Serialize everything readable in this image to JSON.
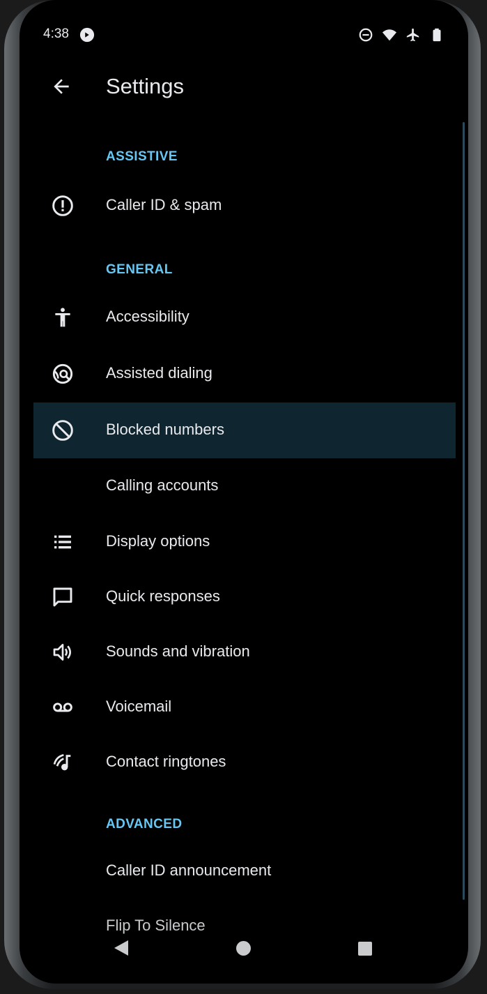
{
  "status_bar": {
    "time": "4:38",
    "icons": [
      "app-notification-icon",
      "do-not-disturb-icon",
      "wifi-icon",
      "airplane-icon",
      "battery-icon"
    ]
  },
  "app_bar": {
    "title": "Settings",
    "back_icon": "arrow-back-icon"
  },
  "sections": {
    "assistive": "ASSISTIVE",
    "general": "GENERAL",
    "advanced": "ADVANCED"
  },
  "items": {
    "caller_id_spam": {
      "label": "Caller ID & spam",
      "icon": "info-circle-icon"
    },
    "accessibility": {
      "label": "Accessibility",
      "icon": "accessibility-icon"
    },
    "assisted_dialing": {
      "label": "Assisted dialing",
      "icon": "assisted-dialing-icon"
    },
    "blocked_numbers": {
      "label": "Blocked numbers",
      "icon": "block-icon"
    },
    "calling_accounts": {
      "label": "Calling accounts"
    },
    "display_options": {
      "label": "Display options",
      "icon": "list-icon"
    },
    "quick_responses": {
      "label": "Quick responses",
      "icon": "message-icon"
    },
    "sounds_vibration": {
      "label": "Sounds and vibration",
      "icon": "volume-icon"
    },
    "voicemail": {
      "label": "Voicemail",
      "icon": "voicemail-icon"
    },
    "contact_ringtones": {
      "label": "Contact ringtones",
      "icon": "ringtone-icon"
    },
    "caller_id_announcement": {
      "label": "Caller ID announcement"
    },
    "flip_to_silence": {
      "label": "Flip To Silence"
    }
  },
  "selected_item": "blocked_numbers",
  "nav_bar": [
    "nav-back-icon",
    "nav-home-icon",
    "nav-recents-icon"
  ],
  "colors": {
    "accent": "#66c7f4",
    "background": "#000000",
    "text": "#e8eaed",
    "selected_row": "#0f2530"
  }
}
